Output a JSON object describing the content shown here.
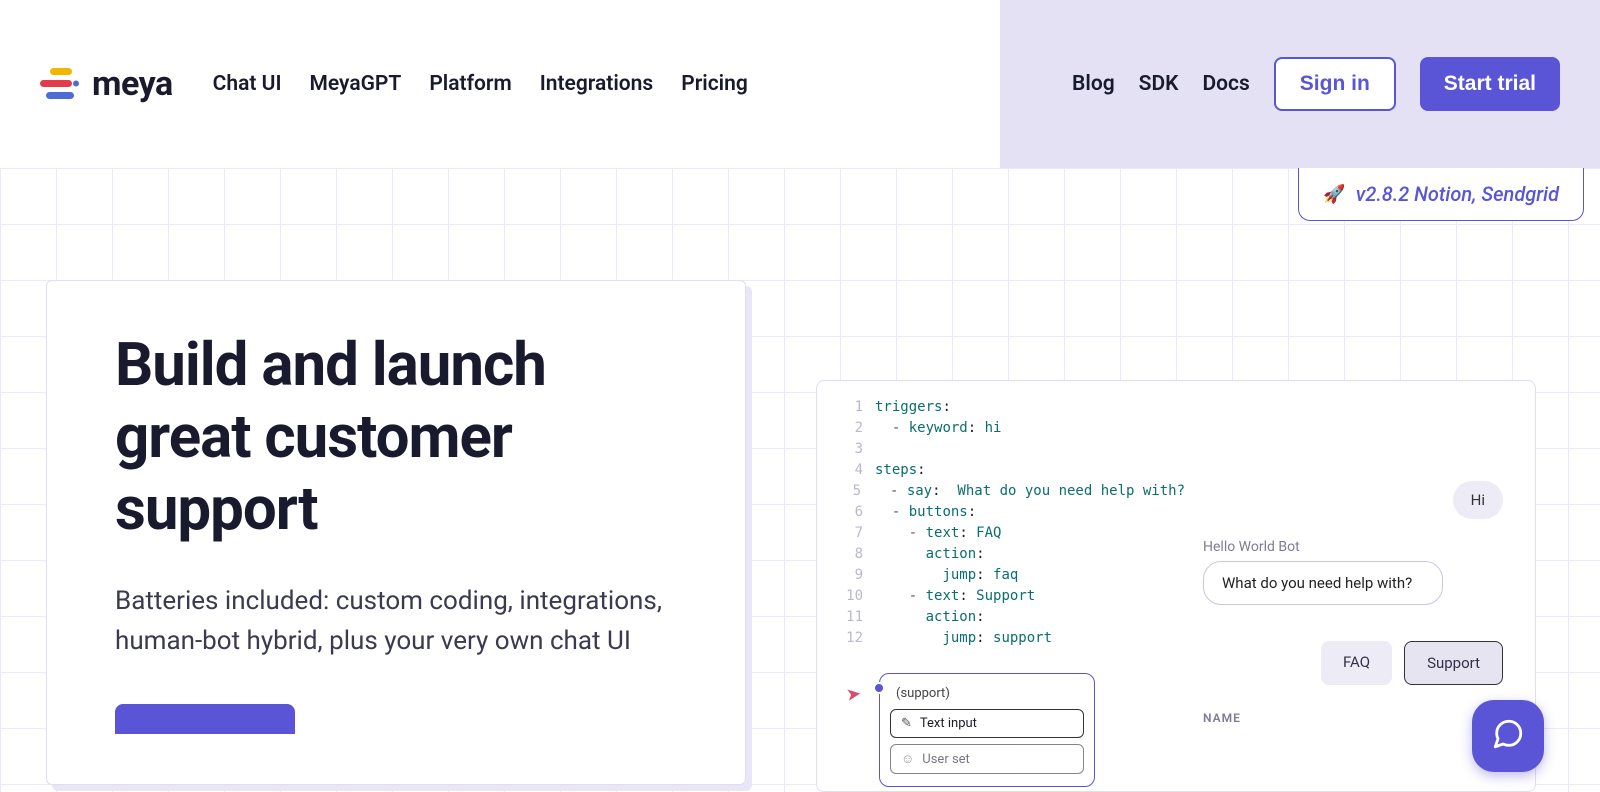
{
  "header": {
    "brand": "meya",
    "nav": [
      "Chat UI",
      "MeyaGPT",
      "Platform",
      "Integrations",
      "Pricing"
    ],
    "secondary_nav": [
      "Blog",
      "SDK",
      "Docs"
    ],
    "signin": "Sign in",
    "start_trial": "Start trial"
  },
  "version_badge": "v2.8.2 Notion, Sendgrid",
  "hero": {
    "title": "Build and launch great customer support",
    "subtitle": "Batteries included: custom coding, integrations, human-bot hybrid, plus your very own chat UI"
  },
  "code": {
    "lines": [
      "triggers:",
      "  - keyword: hi",
      "",
      "steps:",
      "  - say:  What do you need help with?",
      "  - buttons:",
      "    - text: FAQ",
      "      action:",
      "        jump: faq",
      "    - text: Support",
      "      action:",
      "        jump: support"
    ]
  },
  "flow_node": {
    "title": "(support)",
    "rows": [
      "Text input",
      "User set"
    ]
  },
  "chat": {
    "hi": "Hi",
    "bot_name": "Hello World Bot",
    "question": "What do you need help with?",
    "chips": [
      "FAQ",
      "Support"
    ],
    "label_name": "NAME"
  }
}
